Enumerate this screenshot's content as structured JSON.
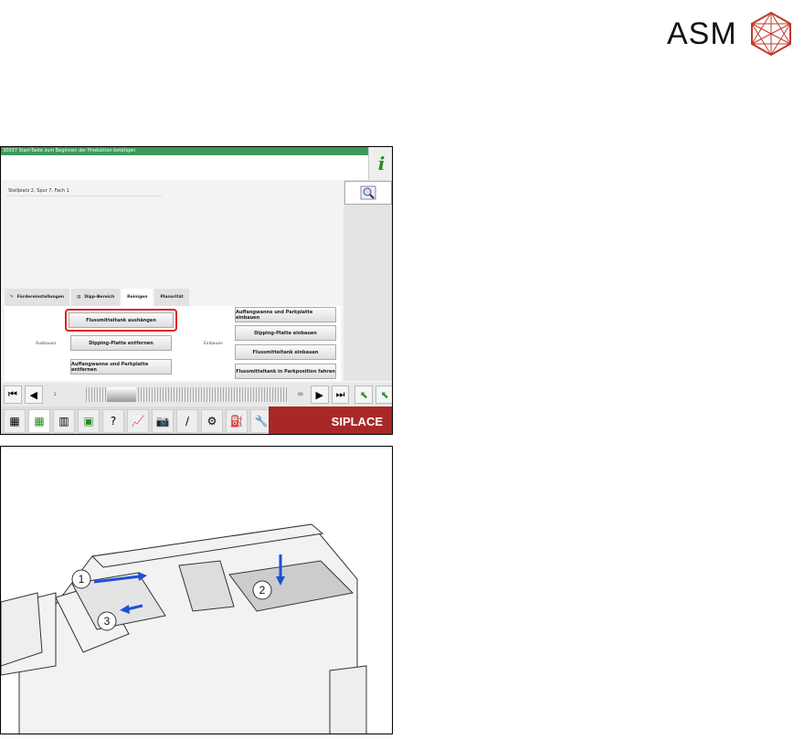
{
  "logo": {
    "text": "ASM"
  },
  "screen": {
    "status_message": "30037 Start-Taste zum Beginnen der Produktion betätigen",
    "location": "Stellplatz 2, Spur 7, Fach 1",
    "tabs": [
      {
        "label": "Fördereinstellungen"
      },
      {
        "label": "Dipp-Bereich"
      },
      {
        "label": "Reinigen"
      },
      {
        "label": "Planarität"
      }
    ],
    "ausbauen_label": "Ausbauen",
    "einbauen_label": "Einbauen",
    "ausbauen_buttons": [
      "Flussmitteltank aushängen",
      "Dipping-Platte entfernen",
      "Auffangwanne und Parkplatte entfernen"
    ],
    "einbauen_buttons": [
      "Auffangwanne und Parkplatte einbauen",
      "Dipping-Platte einbauen",
      "Flussmitteltank einbauen",
      "Flussmitteltank in Parkposition fahren"
    ],
    "slider": {
      "min": "1",
      "max": "60"
    },
    "brand": "SIPLACE"
  },
  "illustration": {
    "callouts": [
      "1",
      "2",
      "3"
    ],
    "accent": "#1e4fd8"
  }
}
